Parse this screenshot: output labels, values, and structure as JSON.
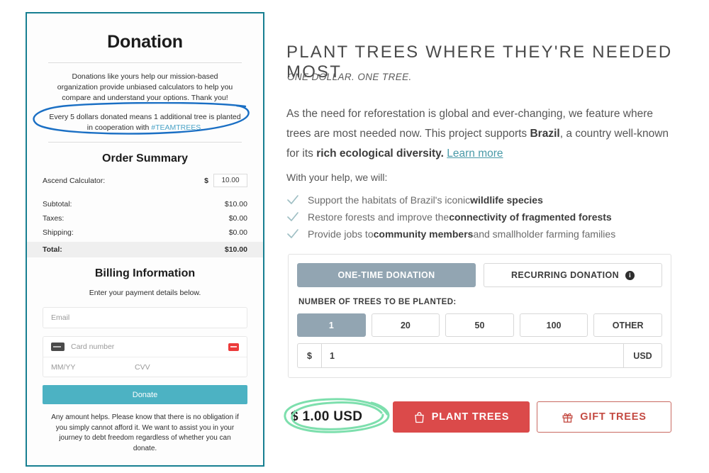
{
  "donation_card": {
    "title": "Donation",
    "intro": "Donations like yours help our mission-based organization provide unbiased calculators to help you compare and understand your options. Thank you!",
    "teamtrees_prefix": "Every 5 dollars donated means 1 additional tree is planted in cooperation with ",
    "teamtrees_tag": "#TEAMTREES",
    "teamtrees_suffix": ".",
    "order_summary": {
      "heading": "Order Summary",
      "line_item_label": "Ascend Calculator:",
      "currency_symbol": "$",
      "line_item_value": "10.00",
      "rows": [
        {
          "label": "Subtotal:",
          "value": "$10.00"
        },
        {
          "label": "Taxes:",
          "value": "$0.00"
        },
        {
          "label": "Shipping:",
          "value": "$0.00"
        }
      ],
      "total_label": "Total:",
      "total_value": "$10.00"
    },
    "billing": {
      "heading": "Billing Information",
      "subtitle": "Enter your payment details below.",
      "email_placeholder": "Email",
      "card_placeholder": "Card number",
      "expiry_placeholder": "MM/YY",
      "cvv_placeholder": "CVV",
      "card_icon": "credit-card-icon",
      "card_brand_icon": "card-brand-icon"
    },
    "donate_button": "Donate",
    "footer": "Any amount helps. Please know that there is no obligation if you simply cannot afford it. We want to assist you in your journey to debt freedom regardless of whether you can donate.",
    "border_color": "#177f91",
    "accent_color": "#4cb2c3"
  },
  "annotations": {
    "blue_ellipse_color": "#1a6fc4",
    "green_ellipse_color": "#7ddfad"
  },
  "right_panel": {
    "title": "PLANT TREES WHERE THEY'RE NEEDED MOST",
    "subtitle": "ONE DOLLAR. ONE TREE.",
    "paragraph": {
      "part1": "As the need for reforestation is global and ever-changing, we feature where trees are most needed now. This project supports ",
      "bold1": "Brazil",
      "part2": ", a country well-known for its ",
      "bold2": "rich ecological diversity.",
      "link": "Learn more"
    },
    "help_intro": "With your help, we will:",
    "checklist": [
      {
        "icon": "check-icon",
        "pre": "Support the habitats of Brazil's iconic ",
        "bold": "wildlife species",
        "post": ""
      },
      {
        "icon": "check-icon",
        "pre": "Restore forests and improve the ",
        "bold": "connectivity of fragmented forests",
        "post": ""
      },
      {
        "icon": "check-icon",
        "pre": "Provide jobs to ",
        "bold": "community members",
        "post": " and smallholder farming families"
      }
    ],
    "donation_widget": {
      "tabs": [
        {
          "label": "ONE-TIME DONATION",
          "active": true
        },
        {
          "label": "RECURRING DONATION",
          "active": false,
          "info_icon": "info-icon"
        }
      ],
      "amount_label": "NUMBER OF TREES TO BE PLANTED:",
      "amounts": [
        {
          "label": "1",
          "active": true
        },
        {
          "label": "20",
          "active": false
        },
        {
          "label": "50",
          "active": false
        },
        {
          "label": "100",
          "active": false
        },
        {
          "label": "OTHER",
          "active": false
        }
      ],
      "currency_prefix": "$",
      "currency_value": "1",
      "currency_suffix": "USD",
      "active_color": "#92a5b2"
    },
    "actions": {
      "total": "$ 1.00 USD",
      "plant_label": "PLANT TREES",
      "plant_icon": "shopping-bag-icon",
      "plant_color": "#db4a4a",
      "gift_label": "GIFT TREES",
      "gift_icon": "gift-icon",
      "gift_color": "#c44a42"
    }
  }
}
